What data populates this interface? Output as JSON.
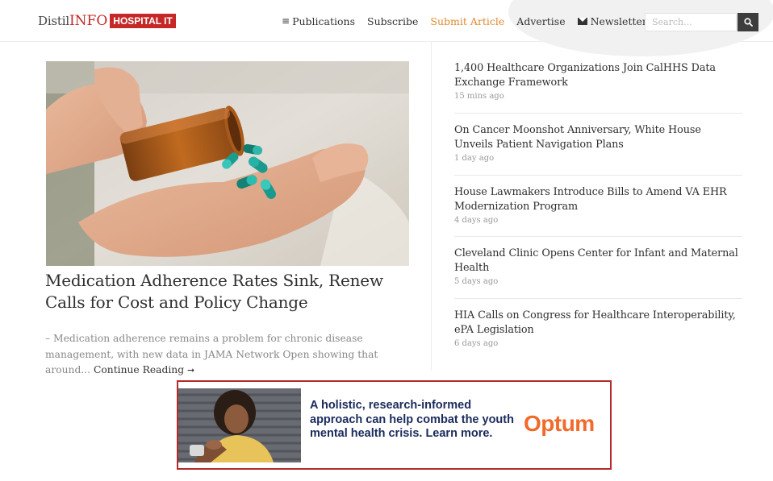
{
  "header": {
    "logo_distil": "Distil",
    "logo_info": "INFO",
    "logo_badge": "HOSPITAL IT",
    "nav": {
      "publications": "Publications",
      "subscribe": "Subscribe",
      "submit_article": "Submit Article",
      "advertise": "Advertise",
      "newsletters": "Newsletters"
    },
    "search_placeholder": "Search...",
    "accent_color": "#e08a2e",
    "brand_color": "#c62828"
  },
  "hero": {
    "title": "Medication Adherence Rates Sink, Renew Calls for Cost and Policy Change",
    "excerpt": "– Medication adherence remains a problem for chronic disease management, with new data in JAMA Network Open showing that around...",
    "continue_label": "Continue Reading",
    "arrow_icon": "right-arrow-icon"
  },
  "news": [
    {
      "title": "1,400 Healthcare Organizations Join CalHHS Data Exchange Framework",
      "time": "15 mins ago"
    },
    {
      "title": "On Cancer Moonshot Anniversary, White House Unveils Patient Navigation Plans",
      "time": "1 day ago"
    },
    {
      "title": "House Lawmakers Introduce Bills to Amend VA EHR Modernization Program",
      "time": "4 days ago"
    },
    {
      "title": "Cleveland Clinic Opens Center for Infant and Maternal Health",
      "time": "5 days ago"
    },
    {
      "title": "HIA Calls on Congress for Healthcare Interoperability, ePA Legislation",
      "time": "6 days ago"
    }
  ],
  "ad": {
    "text": "A holistic, research-informed approach can help combat the youth mental health crisis. Learn more.",
    "logo": "Optum",
    "border_color": "#b22a2a",
    "logo_color": "#f2692a"
  }
}
